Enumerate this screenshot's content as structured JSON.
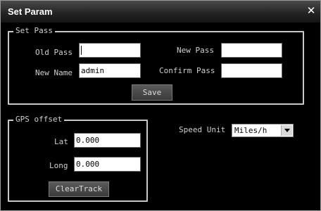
{
  "window": {
    "title": "Set Param",
    "close_icon": "close-icon"
  },
  "set_pass": {
    "legend": "Set Pass",
    "old_pass_label": "Old Pass",
    "old_pass_value": "",
    "new_pass_label": "New Pass",
    "new_pass_value": "",
    "new_name_label": "New Name",
    "new_name_value": "admin",
    "confirm_pass_label": "Confirm Pass",
    "confirm_pass_value": "",
    "save_label": "Save"
  },
  "gps_offset": {
    "legend": "GPS offset",
    "lat_label": "Lat",
    "lat_value": "0.000",
    "long_label": "Long",
    "long_value": "0.000",
    "clear_label": "ClearTrack"
  },
  "speed_unit": {
    "label": "Speed Unit",
    "selected": "Miles/h"
  }
}
